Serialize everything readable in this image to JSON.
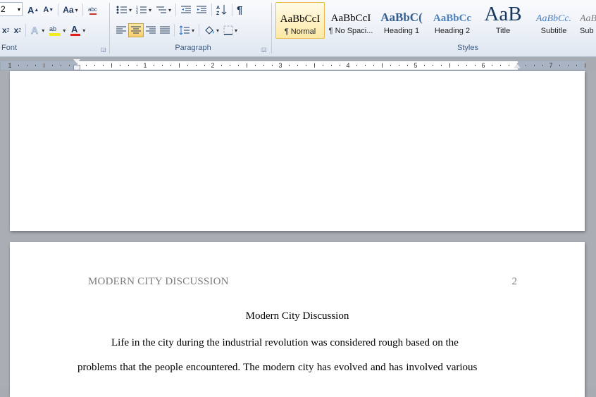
{
  "ribbon": {
    "font_size": "2",
    "font_group_label": "Font",
    "paragraph_group_label": "Paragraph",
    "styles_group_label": "Styles",
    "change_case_label": "Aa",
    "colors": {
      "highlight": "#f5e728",
      "font_color": "#e0201b",
      "accent": "#1e395b"
    },
    "styles": [
      {
        "sample": "AaBbCcI",
        "name": "¶ Normal",
        "selected": true
      },
      {
        "sample": "AaBbCcI",
        "name": "¶ No Spaci..."
      },
      {
        "sample": "AaBbC(",
        "name": "Heading 1"
      },
      {
        "sample": "AaBbCc",
        "name": "Heading 2"
      },
      {
        "sample": "AaB",
        "name": "Title"
      },
      {
        "sample": "AaBbCc.",
        "name": "Subtitle"
      },
      {
        "sample": "AaBbCc",
        "name": "Sub"
      }
    ]
  },
  "ruler": {
    "numbers": [
      "1",
      "1",
      "2",
      "3",
      "4",
      "5",
      "6",
      "7"
    ]
  },
  "document": {
    "header": "MODERN CITY DISCUSSION",
    "page_number": "2",
    "title": "Modern City Discussion",
    "lines": [
      "Life in the city during the industrial revolution was considered rough based on the",
      "problems  that the people  encountered. The modern city has evolved and has involved various"
    ]
  }
}
